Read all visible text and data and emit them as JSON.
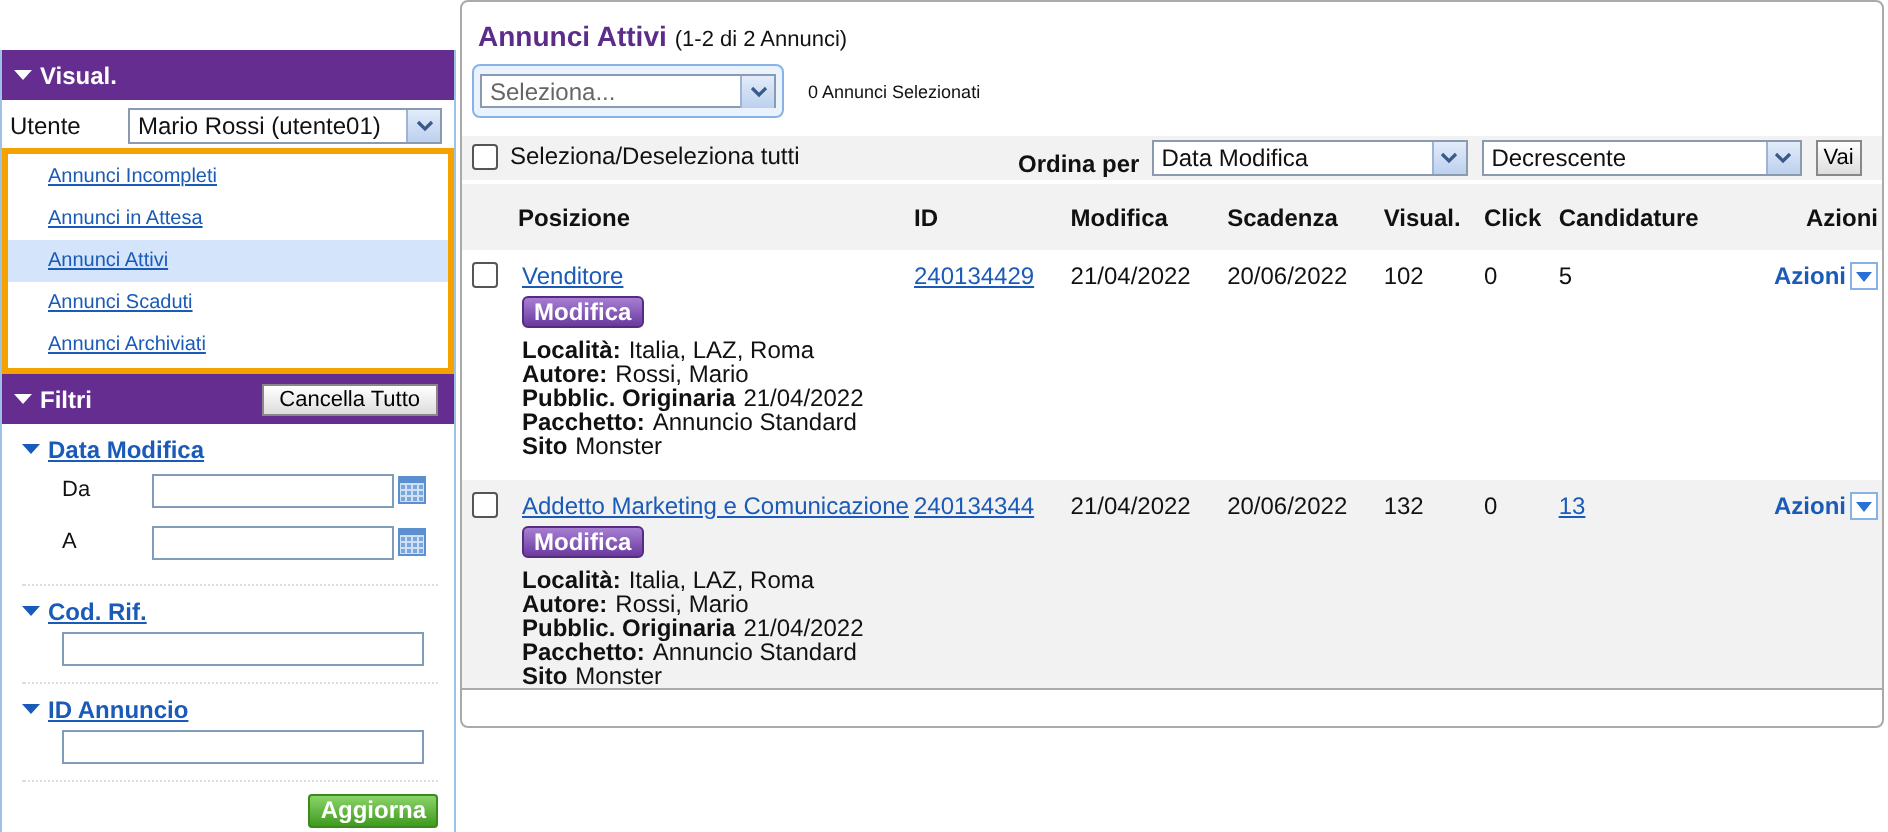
{
  "sidebar": {
    "view_section": {
      "title": "Visual.",
      "expanded": true,
      "user_label": "Utente",
      "user_value": "Mario Rossi (utente01)",
      "items": [
        {
          "label": "Annunci Incompleti",
          "selected": false
        },
        {
          "label": "Annunci in Attesa",
          "selected": false
        },
        {
          "label": "Annunci Attivi",
          "selected": true
        },
        {
          "label": "Annunci Scaduti",
          "selected": false
        },
        {
          "label": "Annunci Archiviati",
          "selected": false
        }
      ]
    },
    "filters_section": {
      "title": "Filtri",
      "expanded": true,
      "clear_button": "Cancella Tutto",
      "groups": [
        {
          "kind": "daterange",
          "title": "Data Modifica",
          "expanded": true,
          "fields": [
            {
              "label": "Da"
            },
            {
              "label": "A"
            }
          ]
        },
        {
          "kind": "text",
          "title": "Cod. Rif.",
          "expanded": true
        },
        {
          "kind": "text",
          "title": "ID Annuncio",
          "expanded": true
        }
      ],
      "update_button": "Aggiorna"
    }
  },
  "main": {
    "title": "Annunci Attivi",
    "subtitle": "(1-2 di 2 Annunci)",
    "bulk_action": {
      "placeholder": "Seleziona..."
    },
    "selected_count": "0 Annunci Selezionati",
    "select_all": {
      "label": "Seleziona/Deseleziona tutti",
      "checked": false
    },
    "sort_label": "Ordina per",
    "sort_field": "Data Modifica",
    "sort_order": "Decrescente",
    "go_button": "Vai",
    "table": {
      "columns": [
        "Posizione",
        "ID",
        "Modifica",
        "Scadenza",
        "Visual.",
        "Click",
        "Candidature",
        "Azioni"
      ],
      "rows": [
        {
          "checked": false,
          "title": "Venditore",
          "edit_button": "Modifica",
          "details": [
            {
              "label": "Località:",
              "value": "Italia, LAZ, Roma"
            },
            {
              "label": "Autore:",
              "value": "Rossi, Mario"
            },
            {
              "label": "Pubblic. Originaria",
              "value": "21/04/2022"
            },
            {
              "label": "Pacchetto:",
              "value": "Annuncio Standard"
            },
            {
              "label": "Sito",
              "value": "Monster"
            }
          ],
          "id": "240134429",
          "modified": "21/04/2022",
          "expires": "20/06/2022",
          "views": "102",
          "clicks": "0",
          "applications": {
            "text": "5",
            "link": false
          },
          "actions": "Azioni"
        },
        {
          "checked": false,
          "title": "Addetto Marketing e Comunicazione",
          "edit_button": "Modifica",
          "details": [
            {
              "label": "Località:",
              "value": "Italia, LAZ, Roma"
            },
            {
              "label": "Autore:",
              "value": "Rossi, Mario"
            },
            {
              "label": "Pubblic. Originaria",
              "value": "21/04/2022"
            },
            {
              "label": "Pacchetto:",
              "value": "Annuncio Standard"
            },
            {
              "label": "Sito",
              "value": "Monster"
            }
          ],
          "id": "240134344",
          "modified": "21/04/2022",
          "expires": "20/06/2022",
          "views": "132",
          "clicks": "0",
          "applications": {
            "text": "13",
            "link": true
          },
          "actions": "Azioni"
        }
      ]
    }
  }
}
